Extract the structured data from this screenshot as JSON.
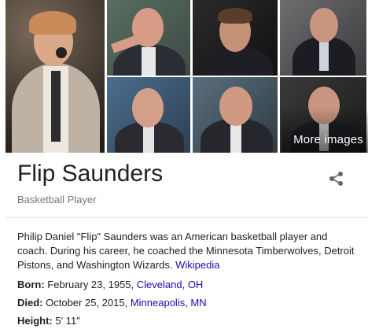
{
  "gallery": {
    "more_images_label": "More images"
  },
  "entity": {
    "name": "Flip Saunders",
    "type": "Basketball Player"
  },
  "description": {
    "text": "Philip Daniel \"Flip\" Saunders was an American basketball player and coach. During his career, he coached the Minnesota Timberwolves, Detroit Pistons, and Washington Wizards.",
    "source_link": "Wikipedia"
  },
  "facts": {
    "born": {
      "label": "Born:",
      "value": "February 23, 1955,",
      "link": "Cleveland, OH"
    },
    "died": {
      "label": "Died:",
      "value": "October 25, 2015,",
      "link": "Minneapolis, MN"
    },
    "height": {
      "label": "Height:",
      "value": "5′ 11″"
    }
  },
  "icons": {
    "share": "share-icon"
  }
}
